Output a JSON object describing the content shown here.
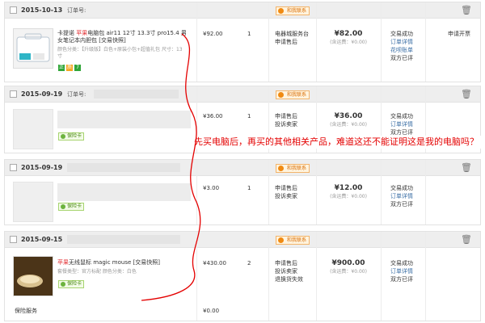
{
  "orders": [
    {
      "date": "2015-10-13",
      "order_label": "订单号:",
      "contact_label": "和我联系",
      "title_prefix": "卡提诺 ",
      "title_brand": "苹果",
      "title_rest": "电脑包 air11 12寸 13.3寸 pro15.4 男女笔记本内胆包 [交易快照]",
      "spec": "颜色分类：【升级版】白色+原装小包+超值礼包  尺寸：13寸",
      "badge_icons": [
        "guarantee-icon",
        "quality-icon",
        "seven-day-icon"
      ],
      "badge_labels": [
        "正",
        "质",
        "7"
      ],
      "price": "¥92.00",
      "qty": "1",
      "actions": [
        "电器城服务台",
        "申请售后"
      ],
      "total": "¥82.00",
      "freight": "(含运费：¥0.00)",
      "status": [
        "交易成功",
        "订单详情",
        "花呗账单",
        "双方已评"
      ],
      "extra_action": "申请开票"
    },
    {
      "date": "2015-09-19",
      "order_label": "订单号:",
      "contact_label": "和我联系",
      "insurance_label": "保险卡",
      "price": "¥36.00",
      "qty": "1",
      "actions": [
        "申请售后",
        "投诉卖家"
      ],
      "total": "¥36.00",
      "freight": "(含运费：¥0.00)",
      "status": [
        "交易成功",
        "订单详情",
        "双方已评"
      ]
    },
    {
      "date": "2015-09-19",
      "contact_label": "和我联系",
      "insurance_label": "保险卡",
      "price": "¥3.00",
      "qty": "1",
      "actions": [
        "申请售后",
        "投诉卖家"
      ],
      "total": "¥12.00",
      "freight": "(含运费：¥0.00)",
      "status": [
        "交易成功",
        "订单详情",
        "双方已评"
      ]
    },
    {
      "date": "2015-09-15",
      "contact_label": "和我联系",
      "title_brand": "苹果",
      "title_rest": "无线鼠标 magic mouse [交易快照]",
      "spec": "套餐类型：官方标配  颜色分类：白色",
      "insurance_label": "保险卡",
      "price": "¥430.00",
      "qty": "2",
      "actions": [
        "申请售后",
        "投诉卖家",
        "退换货失效"
      ],
      "total": "¥900.00",
      "freight": "(含运费：¥0.00)",
      "status": [
        "交易成功",
        "订单详情",
        "双方已评"
      ],
      "service_label": "保险服务",
      "service_price": "¥0.00"
    }
  ],
  "annotation": "先买电脑后，再买的其他相关产品，难道这还不能证明这是我的电脑吗？"
}
